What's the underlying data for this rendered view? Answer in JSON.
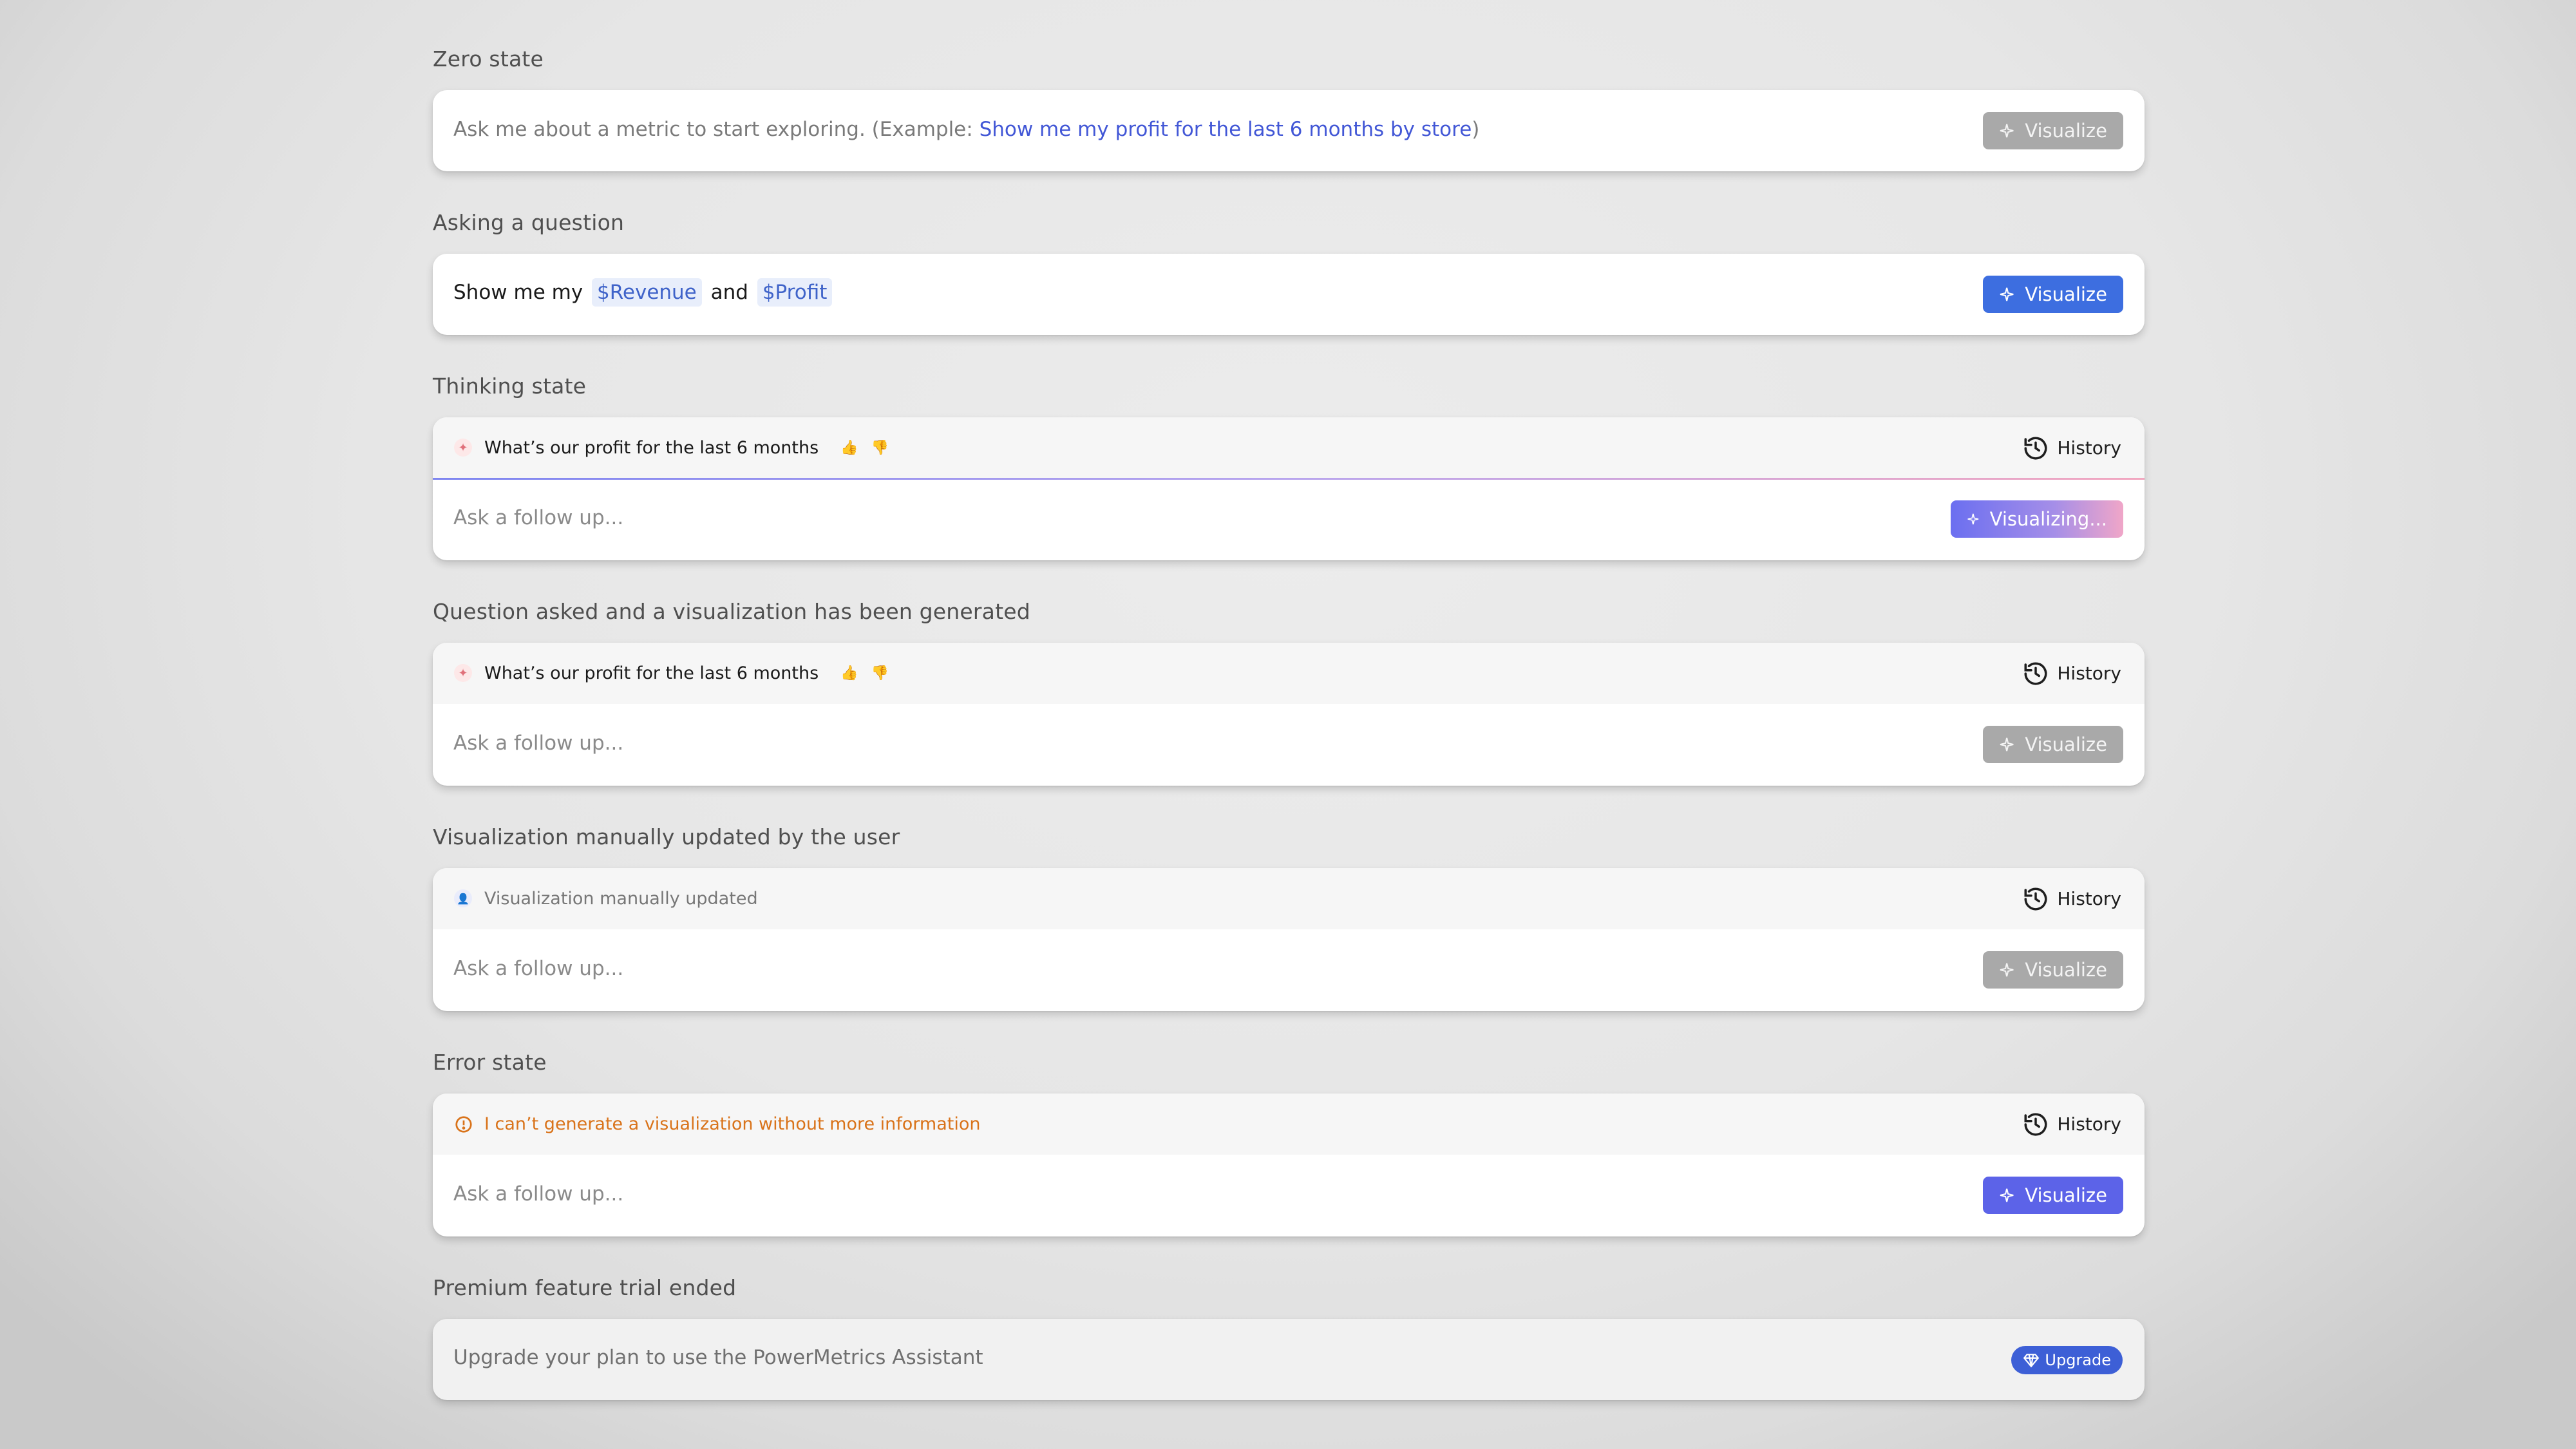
{
  "sections": {
    "zero_state": {
      "label": "Zero state",
      "prefix": "Ask me about a metric to start exploring. (Example: ",
      "example": "Show me my profit for the last 6 months by store",
      "suffix": ")",
      "button": "Visualize"
    },
    "asking": {
      "label": "Asking a question",
      "text1": "Show me my",
      "chip1": "$Revenue",
      "text2": "and",
      "chip2": "$Profit",
      "button": "Visualize"
    },
    "thinking": {
      "label": "Thinking state",
      "question": "What’s our profit for the last 6 months",
      "history": "History",
      "placeholder": "Ask a follow up...",
      "button": "Visualizing..."
    },
    "generated": {
      "label": "Question asked and a visualization has been generated",
      "question": "What’s our profit for the last 6 months",
      "history": "History",
      "placeholder": "Ask a follow up...",
      "button": "Visualize"
    },
    "manual": {
      "label": "Visualization manually updated by the user",
      "status": "Visualization manually updated",
      "history": "History",
      "placeholder": "Ask a follow up...",
      "button": "Visualize"
    },
    "error": {
      "label": "Error state",
      "message": "I can’t generate a visualization without more information",
      "history": "History",
      "placeholder": "Ask a follow up...",
      "button": "Visualize"
    },
    "trial": {
      "label": "Premium feature trial ended",
      "message": "Upgrade your plan to use the PowerMetrics Assistant",
      "button": "Upgrade"
    }
  },
  "icons": {
    "sparkle": "sparkle-icon",
    "history": "history-icon",
    "thumbs_up": "thumbs-up-icon",
    "thumbs_down": "thumbs-down-icon",
    "user": "user-icon",
    "alert": "alert-circle-icon",
    "diamond": "diamond-icon"
  },
  "colors": {
    "primary_blue": "#3d6ee0",
    "indigo": "#5c63e8",
    "disabled_grey": "#a9a9a9",
    "error_orange": "#d9731a",
    "chip_text": "#3f63c9"
  }
}
